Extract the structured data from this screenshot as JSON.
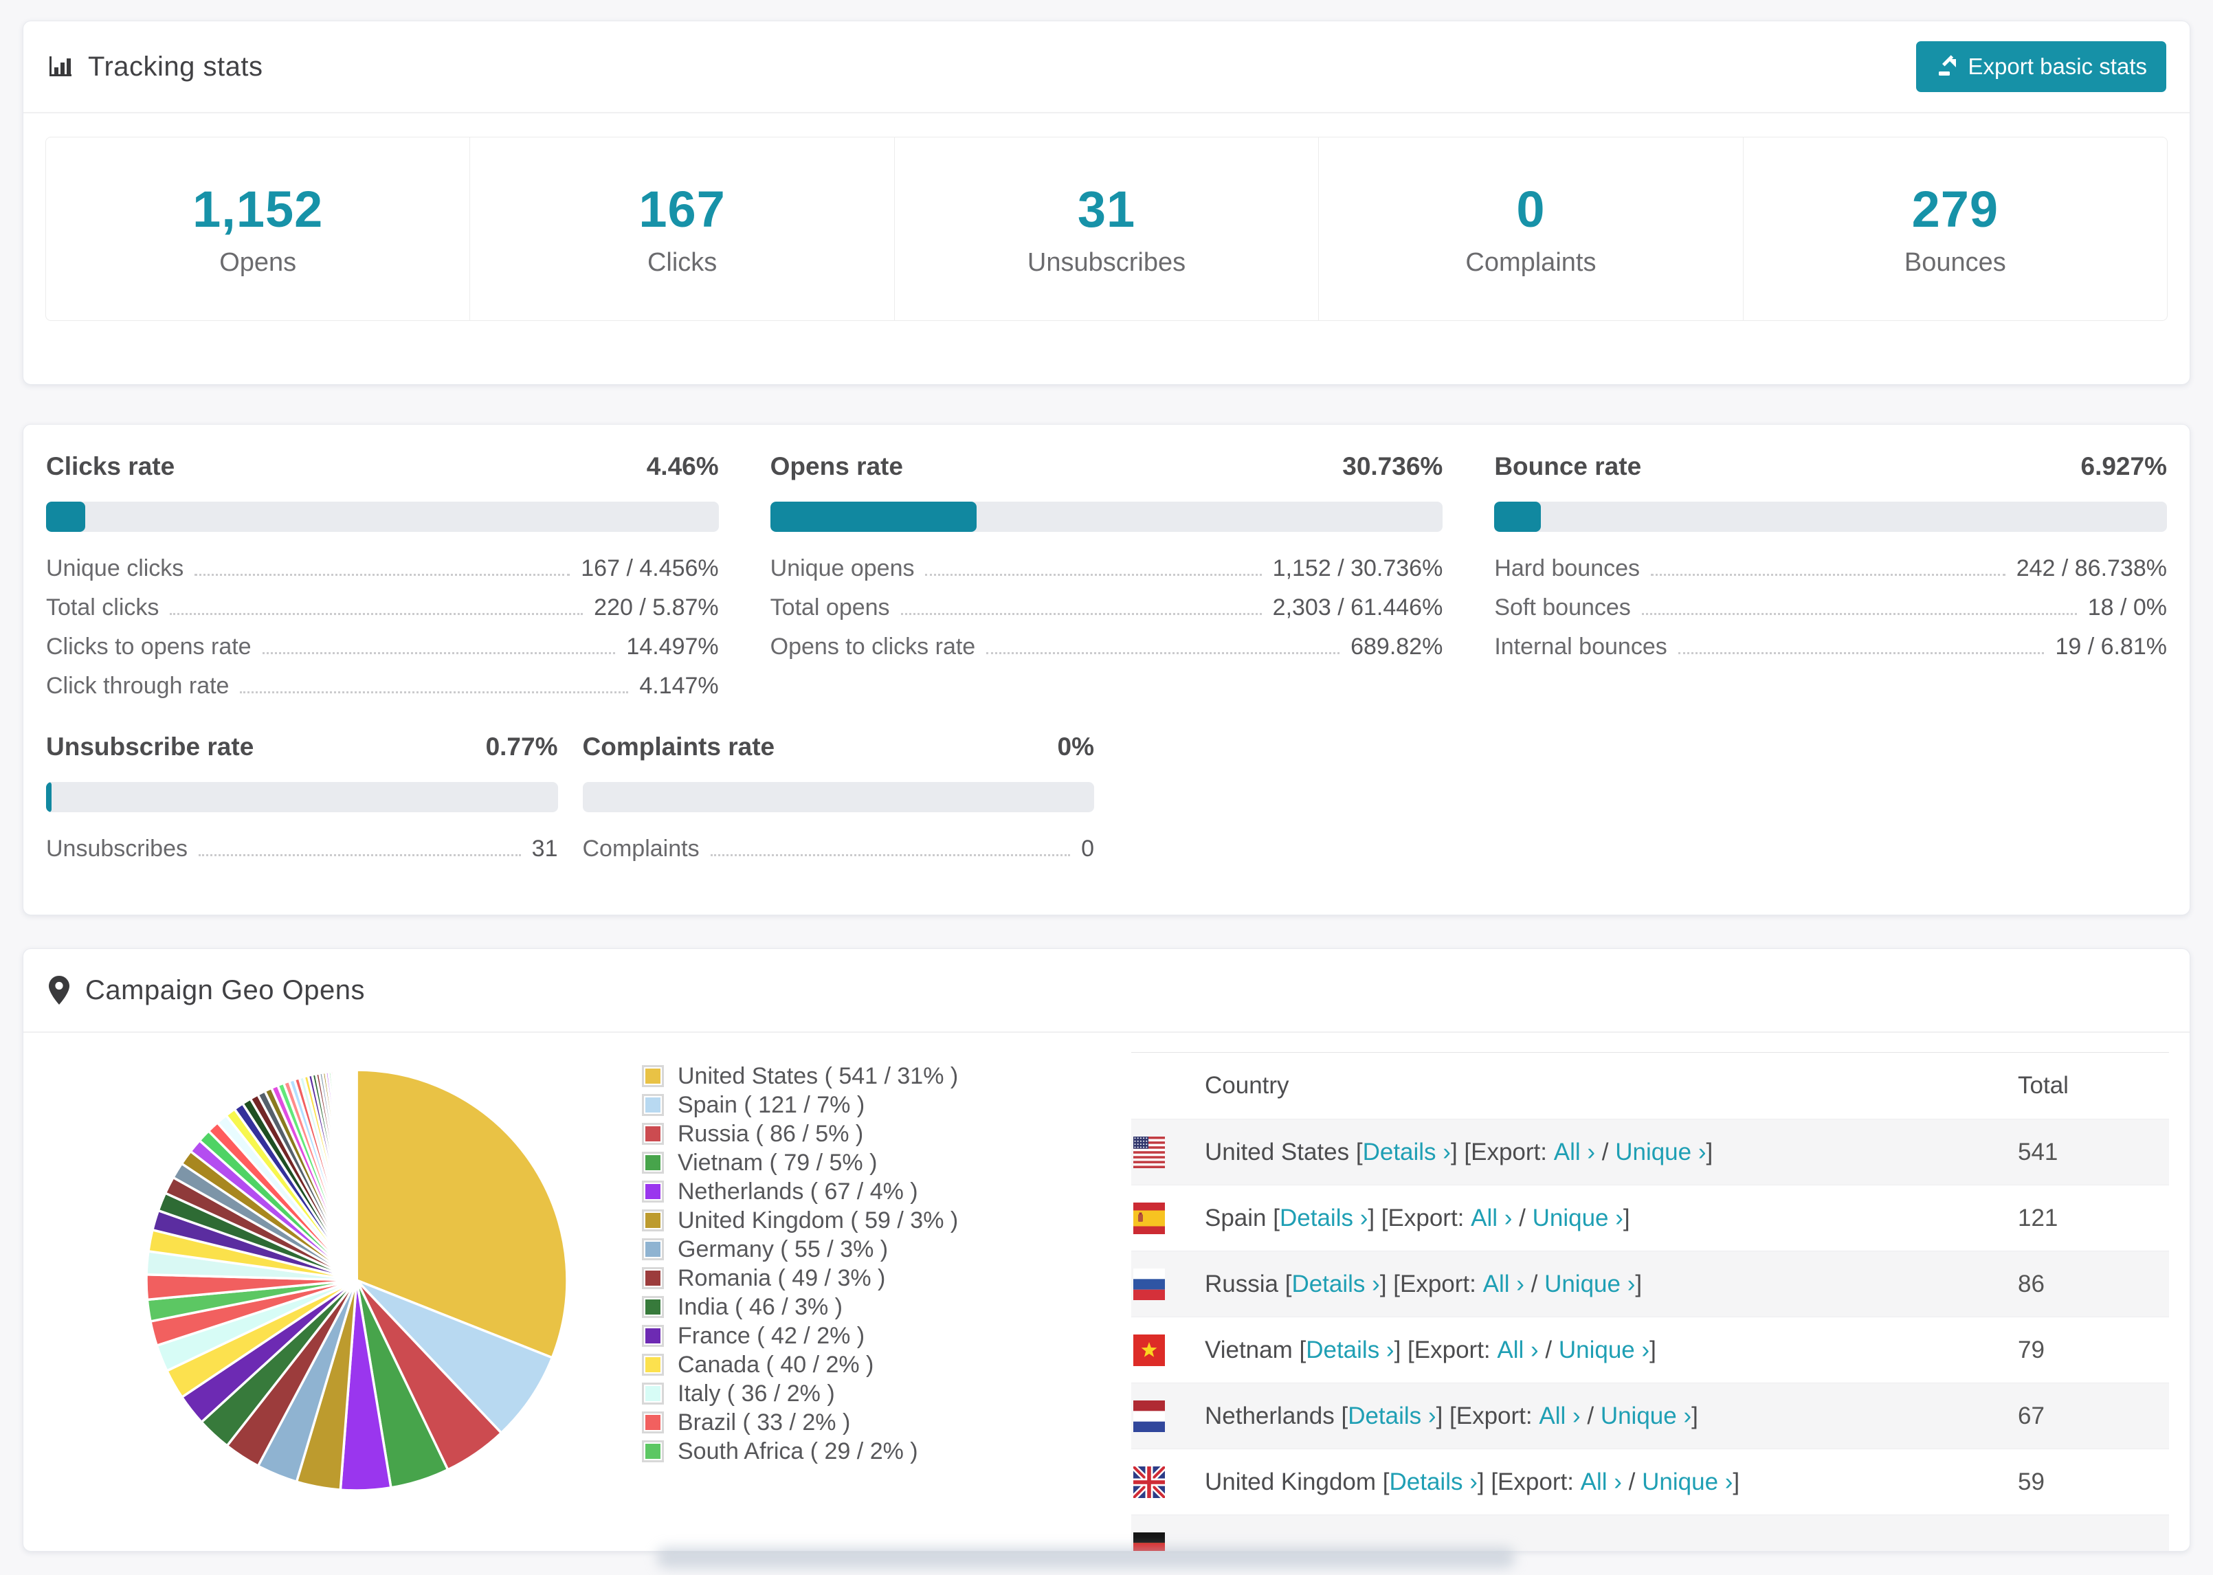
{
  "accent_color": "#1792a8",
  "link_color": "#1f9fb4",
  "header": {
    "title": "Tracking stats",
    "export_label": "Export basic stats"
  },
  "summary_stats": [
    {
      "value": "1,152",
      "label": "Opens"
    },
    {
      "value": "167",
      "label": "Clicks"
    },
    {
      "value": "31",
      "label": "Unsubscribes"
    },
    {
      "value": "0",
      "label": "Complaints"
    },
    {
      "value": "279",
      "label": "Bounces"
    }
  ],
  "rate_panels_row1": [
    {
      "title": "Clicks rate",
      "percent_label": "4.46%",
      "bar_percent": 5.8,
      "rows": [
        {
          "label": "Unique clicks",
          "value": "167 / 4.456%"
        },
        {
          "label": "Total clicks",
          "value": "220 / 5.87%"
        },
        {
          "label": "Clicks to opens rate",
          "value": "14.497%"
        },
        {
          "label": "Click through rate",
          "value": "4.147%"
        }
      ]
    },
    {
      "title": "Opens rate",
      "percent_label": "30.736%",
      "bar_percent": 30.736,
      "rows": [
        {
          "label": "Unique opens",
          "value": "1,152 / 30.736%"
        },
        {
          "label": "Total opens",
          "value": "2,303 / 61.446%"
        },
        {
          "label": "Opens to clicks rate",
          "value": "689.82%"
        }
      ]
    },
    {
      "title": "Bounce rate",
      "percent_label": "6.927%",
      "bar_percent": 6.927,
      "rows": [
        {
          "label": "Hard bounces",
          "value": "242 / 86.738%"
        },
        {
          "label": "Soft bounces",
          "value": "18 / 0%"
        },
        {
          "label": "Internal bounces",
          "value": "19 / 6.81%"
        }
      ]
    }
  ],
  "rate_panels_row2": [
    {
      "title": "Unsubscribe rate",
      "percent_label": "0.77%",
      "bar_percent": 1.1,
      "rows": [
        {
          "label": "Unsubscribes",
          "value": "31"
        }
      ]
    },
    {
      "title": "Complaints rate",
      "percent_label": "0%",
      "bar_percent": 0,
      "rows": [
        {
          "label": "Complaints",
          "value": "0"
        }
      ]
    }
  ],
  "geo": {
    "title": "Campaign Geo Opens",
    "table": {
      "columns": [
        "Country",
        "Total"
      ],
      "links": {
        "details": "Details ›",
        "export_prefix": "Export:",
        "all": "All ›",
        "unique": "Unique ›"
      },
      "rows": [
        {
          "flag": "us",
          "country": "United States",
          "total": "541"
        },
        {
          "flag": "es",
          "country": "Spain",
          "total": "121"
        },
        {
          "flag": "ru",
          "country": "Russia",
          "total": "86"
        },
        {
          "flag": "vn",
          "country": "Vietnam",
          "total": "79"
        },
        {
          "flag": "nl",
          "country": "Netherlands",
          "total": "67"
        },
        {
          "flag": "gb",
          "country": "United Kingdom",
          "total": "59"
        },
        {
          "flag": "de",
          "country": "",
          "total": "",
          "partial": true
        }
      ]
    }
  },
  "chart_data": {
    "type": "pie",
    "title": "Campaign Geo Opens",
    "unit": "opens",
    "legend_position": "right",
    "start_angle_deg": -90,
    "direction": "clockwise",
    "total": 1745,
    "categories": [
      "United States",
      "Spain",
      "Russia",
      "Vietnam",
      "Netherlands",
      "United Kingdom",
      "Germany",
      "Romania",
      "India",
      "France",
      "Canada",
      "Italy",
      "Brazil",
      "South Africa"
    ],
    "values": [
      541,
      121,
      86,
      79,
      67,
      59,
      55,
      49,
      46,
      42,
      40,
      36,
      33,
      29
    ],
    "percents": [
      31,
      7,
      5,
      5,
      4,
      3,
      3,
      3,
      3,
      2,
      2,
      2,
      2,
      2
    ],
    "colors": [
      "#e9c245",
      "#b8d9f1",
      "#cc4b50",
      "#47a44b",
      "#9a36ee",
      "#bd9b2e",
      "#8fb3d1",
      "#9c3c3c",
      "#377a3b",
      "#6d2ab3",
      "#fce14e",
      "#d7fcf6",
      "#f2605f",
      "#5cc763"
    ],
    "other_tail": {
      "total_value": 462,
      "slice_count": 50,
      "decay": 0.93,
      "palette": [
        "#f15f5f",
        "#d9f9f4",
        "#fbe14b",
        "#5b2da0",
        "#2e6b34",
        "#8f3a3a",
        "#7d95a8",
        "#a8871f",
        "#b44df0",
        "#4fd364",
        "#ff5c5c",
        "#e9fcff",
        "#f7f74e",
        "#34309b",
        "#1e4f22",
        "#732626",
        "#55606b",
        "#8a7a1e",
        "#e04de0",
        "#62e87a",
        "#ff8a8a",
        "#b3e0ff"
      ]
    },
    "legend_format": "{name} ( {value} / {percent}% )"
  }
}
